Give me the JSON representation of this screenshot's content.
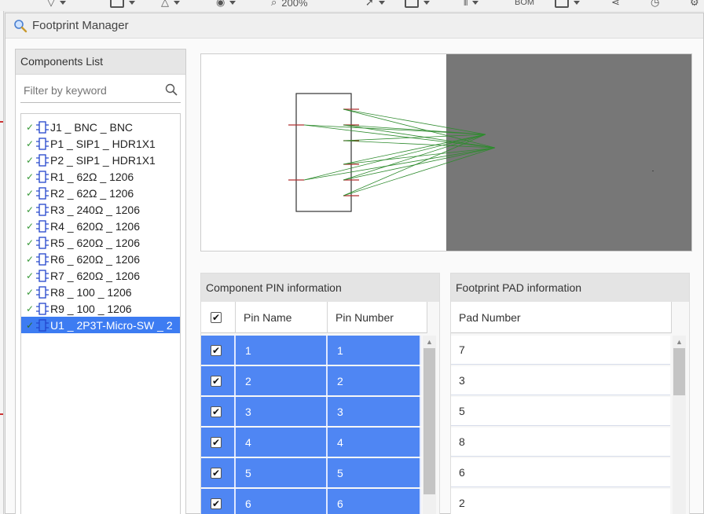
{
  "toolbar": {
    "zoom_text": "200%",
    "bom_label": "BOM"
  },
  "dialog": {
    "title": "Footprint Manager"
  },
  "components": {
    "header": "Components List",
    "filter_placeholder": "Filter by keyword",
    "items": [
      {
        "label": "J1 _ BNC _ BNC",
        "checked": true,
        "selected": false
      },
      {
        "label": "P1 _ SIP1 _ HDR1X1",
        "checked": true,
        "selected": false
      },
      {
        "label": "P2 _ SIP1 _ HDR1X1",
        "checked": true,
        "selected": false
      },
      {
        "label": "R1 _ 62Ω _ 1206",
        "checked": true,
        "selected": false
      },
      {
        "label": "R2 _ 62Ω _ 1206",
        "checked": true,
        "selected": false
      },
      {
        "label": "R3 _ 240Ω _ 1206",
        "checked": true,
        "selected": false
      },
      {
        "label": "R4 _ 620Ω _ 1206",
        "checked": true,
        "selected": false
      },
      {
        "label": "R5 _ 620Ω _ 1206",
        "checked": true,
        "selected": false
      },
      {
        "label": "R6 _ 620Ω _ 1206",
        "checked": true,
        "selected": false
      },
      {
        "label": "R7 _ 620Ω _ 1206",
        "checked": true,
        "selected": false
      },
      {
        "label": "R8 _ 100 _ 1206",
        "checked": true,
        "selected": false
      },
      {
        "label": "R9 _ 100 _ 1206",
        "checked": true,
        "selected": false
      },
      {
        "label": "U1 _ 2P3T-Micro-SW _ 2",
        "checked": true,
        "selected": true
      }
    ]
  },
  "pin_info": {
    "header": "Component PIN information",
    "col_name": "Pin Name",
    "col_number": "Pin Number",
    "rows": [
      {
        "name": "1",
        "number": "1",
        "checked": true
      },
      {
        "name": "2",
        "number": "2",
        "checked": true
      },
      {
        "name": "3",
        "number": "3",
        "checked": true
      },
      {
        "name": "4",
        "number": "4",
        "checked": true
      },
      {
        "name": "5",
        "number": "5",
        "checked": true
      },
      {
        "name": "6",
        "number": "6",
        "checked": true
      }
    ]
  },
  "pad_info": {
    "header": "Footprint PAD information",
    "col_pad": "Pad Number",
    "rows": [
      "7",
      "3",
      "5",
      "8",
      "6",
      "2"
    ]
  },
  "colors": {
    "selection": "#3d7cf2",
    "row_highlight": "#4f86f3",
    "ratsnest": "#2e8b2e",
    "pin_mark": "#b03030",
    "footprint_bg": "#777777"
  }
}
